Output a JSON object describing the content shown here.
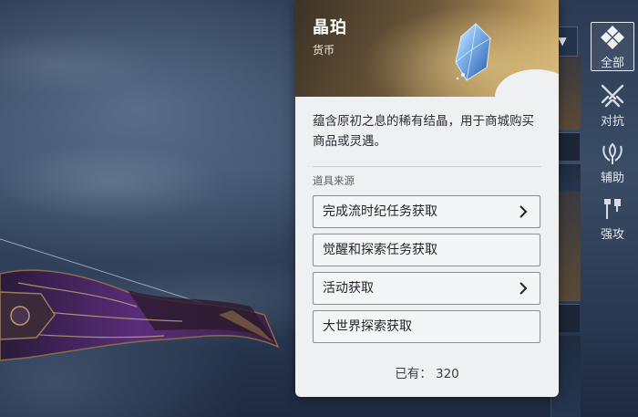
{
  "item": {
    "name": "晶珀",
    "type": "货币",
    "description": "蕴含原初之息的稀有结晶，用于商城购买商品或灵遇。",
    "sources_title": "道具来源",
    "sources": [
      {
        "label": "完成流时纪任务获取",
        "has_arrow": true
      },
      {
        "label": "觉醒和探索任务获取",
        "has_arrow": false
      },
      {
        "label": "活动获取",
        "has_arrow": true
      },
      {
        "label": "大世界探索获取",
        "has_arrow": false
      }
    ],
    "owned_label": "已有：",
    "owned_value": "320"
  },
  "categories": [
    {
      "label": "全部",
      "icon": "grid-icon",
      "active": true
    },
    {
      "label": "对抗",
      "icon": "crossed-swords-icon",
      "active": false
    },
    {
      "label": "辅助",
      "icon": "support-icon",
      "active": false
    },
    {
      "label": "强攻",
      "icon": "assault-icon",
      "active": false
    }
  ],
  "dropdown_glyph": "▼",
  "colors": {
    "panel_bg": "#eef0f2",
    "header_gold": "#b9975c",
    "text_dark": "#1f232a",
    "nav_text": "#e6e9ef"
  }
}
